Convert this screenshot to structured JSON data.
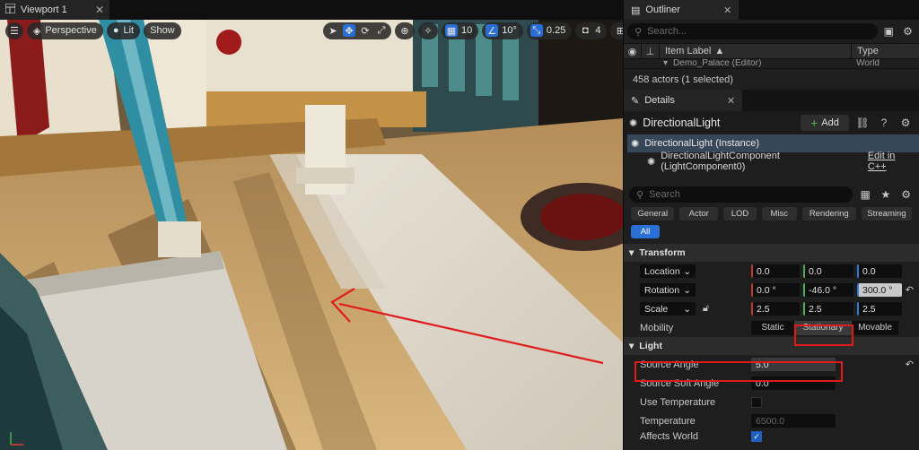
{
  "viewport": {
    "tab_label": "Viewport 1",
    "perspective_label": "Perspective",
    "lit_label": "Lit",
    "show_label": "Show",
    "grid_snap_value": "10",
    "rotation_snap_value": "10°",
    "scale_snap_value": "0.25",
    "camera_speed_value": "4"
  },
  "outliner": {
    "tab_label": "Outliner",
    "search_placeholder": "Search...",
    "column_item_label": "Item Label",
    "column_type": "Type",
    "row_label": "Demo_Palace (Editor)",
    "row_type": "World",
    "status_text": "458 actors (1 selected)"
  },
  "details": {
    "tab_label": "Details",
    "actor_name": "DirectionalLight",
    "add_label": "Add",
    "instance_label": "DirectionalLight (Instance)",
    "component_label": "DirectionalLightComponent (LightComponent0)",
    "edit_link": "Edit in C++",
    "search_placeholder": "Search",
    "filters_row1": [
      "General",
      "Actor",
      "LOD",
      "Misc",
      "Rendering",
      "Streaming"
    ],
    "filter_all": "All",
    "transform_header": "Transform",
    "location_label": "Location",
    "location": [
      "0.0",
      "0.0",
      "0.0"
    ],
    "rotation_label": "Rotation",
    "rotation": [
      "0.0 °",
      "-46.0 °",
      "300.0 °"
    ],
    "scale_label": "Scale",
    "scale": [
      "2.5",
      "2.5",
      "2.5"
    ],
    "mobility_label": "Mobility",
    "mobility_options": [
      "Static",
      "Stationary",
      "Movable"
    ],
    "light_header": "Light",
    "source_angle_label": "Source Angle",
    "source_angle_value": "5.0",
    "source_soft_angle_label": "Source Soft Angle",
    "source_soft_angle_value": "0.0",
    "use_temperature_label": "Use Temperature",
    "temperature_label": "Temperature",
    "temperature_value": "6500.0",
    "affects_world_label": "Affects World"
  },
  "colors": {
    "accent_blue": "#2a6fd6",
    "highlight_red": "#e01b1b"
  }
}
